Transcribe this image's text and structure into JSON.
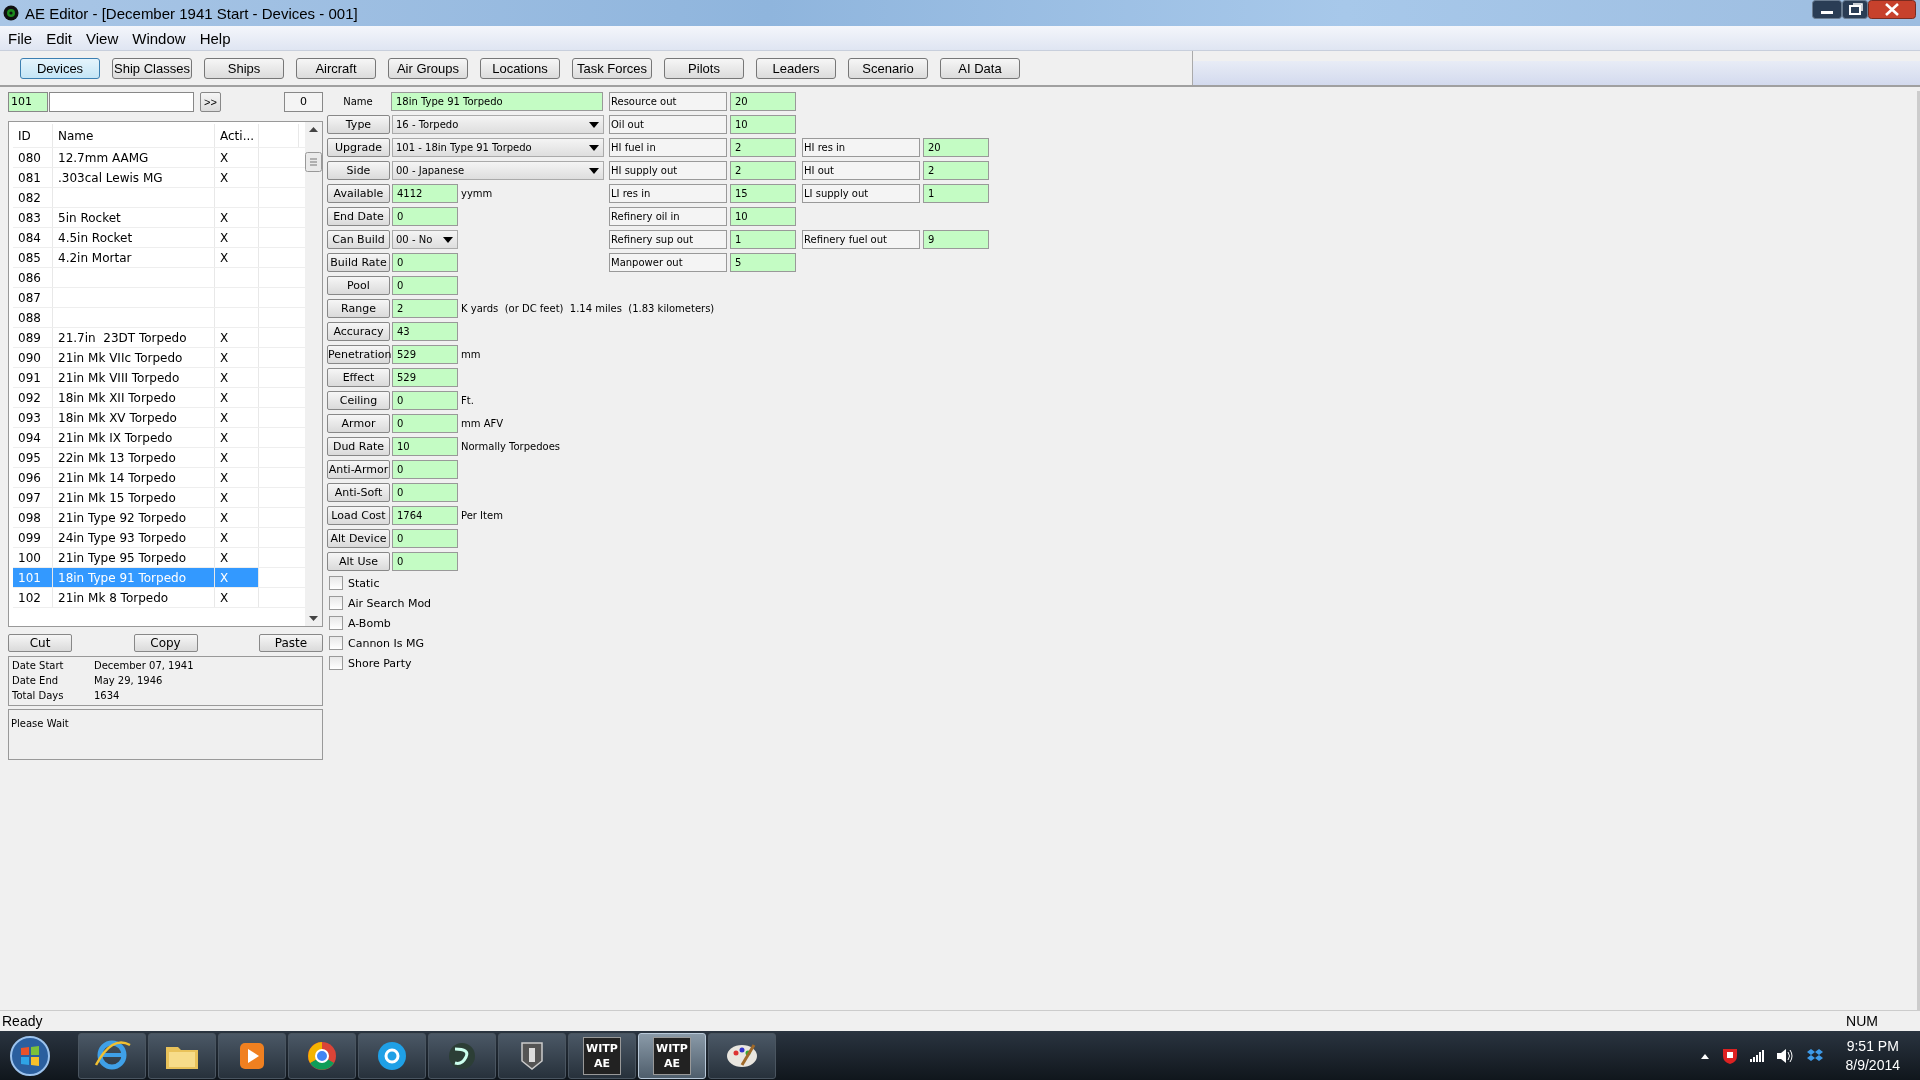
{
  "window": {
    "title": "AE Editor - [December 1941 Start - Devices - 001]"
  },
  "menu": [
    "File",
    "Edit",
    "View",
    "Window",
    "Help"
  ],
  "tabs": [
    {
      "label": "Devices",
      "selected": true
    },
    {
      "label": "Ship Classes",
      "selected": false
    },
    {
      "label": "Ships",
      "selected": false
    },
    {
      "label": "Aircraft",
      "selected": false
    },
    {
      "label": "Air Groups",
      "selected": false
    },
    {
      "label": "Locations",
      "selected": false
    },
    {
      "label": "Task Forces",
      "selected": false
    },
    {
      "label": "Pilots",
      "selected": false
    },
    {
      "label": "Leaders",
      "selected": false
    },
    {
      "label": "Scenario",
      "selected": false
    },
    {
      "label": "AI Data",
      "selected": false
    }
  ],
  "finder": {
    "id_value": "101",
    "go_button": ">>",
    "counter": "0"
  },
  "device_list": {
    "columns": [
      "ID",
      "Name",
      "Acti..."
    ],
    "rows": [
      {
        "id": "080",
        "name": "12.7mm AAMG",
        "active": "X",
        "selected": false
      },
      {
        "id": "081",
        "name": ".303cal Lewis MG",
        "active": "X",
        "selected": false
      },
      {
        "id": "082",
        "selected": false
      },
      {
        "id": "083",
        "name": "5in Rocket",
        "active": "X",
        "selected": false
      },
      {
        "id": "084",
        "name": "4.5in Rocket",
        "active": "X",
        "selected": false
      },
      {
        "id": "085",
        "name": "4.2in Mortar",
        "active": "X",
        "selected": false
      },
      {
        "id": "086",
        "selected": false
      },
      {
        "id": "087",
        "selected": false
      },
      {
        "id": "088",
        "selected": false
      },
      {
        "id": "089",
        "name": "21.7in  23DT Torpedo",
        "active": "X",
        "selected": false
      },
      {
        "id": "090",
        "name": "21in Mk VIIc Torpedo",
        "active": "X",
        "selected": false
      },
      {
        "id": "091",
        "name": "21in Mk VIII Torpedo",
        "active": "X",
        "selected": false
      },
      {
        "id": "092",
        "name": "18in Mk XII Torpedo",
        "active": "X",
        "selected": false
      },
      {
        "id": "093",
        "name": "18in Mk XV Torpedo",
        "active": "X",
        "selected": false
      },
      {
        "id": "094",
        "name": "21in Mk IX Torpedo",
        "active": "X",
        "selected": false
      },
      {
        "id": "095",
        "name": "22in Mk 13 Torpedo",
        "active": "X",
        "selected": false
      },
      {
        "id": "096",
        "name": "21in Mk 14 Torpedo",
        "active": "X",
        "selected": false
      },
      {
        "id": "097",
        "name": "21in Mk 15 Torpedo",
        "active": "X",
        "selected": false
      },
      {
        "id": "098",
        "name": "21in Type 92 Torpedo",
        "active": "X",
        "selected": false
      },
      {
        "id": "099",
        "name": "24in Type 93 Torpedo",
        "active": "X",
        "selected": false
      },
      {
        "id": "100",
        "name": "21in Type 95 Torpedo",
        "active": "X",
        "selected": false
      },
      {
        "id": "101",
        "name": "18in Type 91 Torpedo",
        "active": "X",
        "selected": true
      },
      {
        "id": "102",
        "name": "21in Mk 8 Torpedo",
        "active": "X",
        "selected": false
      }
    ]
  },
  "clipboard_buttons": [
    "Cut",
    "Copy",
    "Paste"
  ],
  "dates": [
    {
      "label": "Date Start",
      "value": "December 07, 1941"
    },
    {
      "label": "Date End",
      "value": "May 29, 1946"
    },
    {
      "label": "Total Days",
      "value": "1634"
    }
  ],
  "log": "Please Wait",
  "form": [
    {
      "kind": "text",
      "label": "Name",
      "value": "18in Type 91 Torpedo"
    },
    {
      "kind": "select",
      "label": "Type",
      "value": "16 - Torpedo"
    },
    {
      "kind": "select",
      "label": "Upgrade",
      "value": "101 - 18in Type 91 Torpedo"
    },
    {
      "kind": "select",
      "label": "Side",
      "value": "00 - Japanese"
    },
    {
      "kind": "input",
      "label": "Available",
      "value": "4112",
      "unit": "yymm"
    },
    {
      "kind": "input",
      "label": "End Date",
      "value": "0"
    },
    {
      "kind": "small_select",
      "label": "Can Build",
      "value": "00 - No"
    },
    {
      "kind": "input",
      "label": "Build Rate",
      "value": "0"
    },
    {
      "kind": "input",
      "label": "Pool",
      "value": "0"
    },
    {
      "kind": "input",
      "label": "Range",
      "value": "2",
      "unit": "K yards  (or DC feet)  1.14 miles  (1.83 kilometers)"
    },
    {
      "kind": "input",
      "label": "Accuracy",
      "value": "43"
    },
    {
      "kind": "input",
      "label": "Penetration",
      "value": "529",
      "unit": "mm"
    },
    {
      "kind": "input",
      "label": "Effect",
      "value": "529"
    },
    {
      "kind": "input",
      "label": "Ceiling",
      "value": "0",
      "unit": "Ft."
    },
    {
      "kind": "input",
      "label": "Armor",
      "value": "0",
      "unit": "mm AFV"
    },
    {
      "kind": "input",
      "label": "Dud Rate",
      "value": "10",
      "unit": "Normally Torpedoes"
    },
    {
      "kind": "input",
      "label": "Anti-Armor",
      "value": "0"
    },
    {
      "kind": "input",
      "label": "Anti-Soft",
      "value": "0"
    },
    {
      "kind": "input",
      "label": "Load Cost",
      "value": "1764",
      "unit": "Per Item"
    },
    {
      "kind": "input",
      "label": "Alt Device",
      "value": "0"
    },
    {
      "kind": "input",
      "label": "Alt Use",
      "value": "0"
    }
  ],
  "flags": [
    {
      "label": "Static",
      "checked": false
    },
    {
      "label": "Air Search Mod",
      "checked": false
    },
    {
      "label": "A-Bomb",
      "checked": false
    },
    {
      "label": "Cannon Is MG",
      "checked": false
    },
    {
      "label": "Shore Party",
      "checked": false
    }
  ],
  "resources": [
    [
      {
        "label": "Resource out",
        "value": "20"
      }
    ],
    [
      {
        "label": "Oil out",
        "value": "10"
      }
    ],
    [
      {
        "label": "HI fuel in",
        "value": "2"
      },
      {
        "label": "HI res in",
        "value": "20"
      }
    ],
    [
      {
        "label": "HI supply out",
        "value": "2"
      },
      {
        "label": "HI out",
        "value": "2"
      }
    ],
    [
      {
        "label": "LI res in",
        "value": "15"
      },
      {
        "label": "LI supply out",
        "value": "1"
      }
    ],
    [
      {
        "label": "Refinery oil in",
        "value": "10"
      }
    ],
    [
      {
        "label": "Refinery sup out",
        "value": "1"
      },
      {
        "label": "Refinery fuel out",
        "value": "9"
      }
    ],
    [
      {
        "label": "Manpower out",
        "value": "5"
      }
    ]
  ],
  "status_bar": {
    "text": "Ready",
    "num": "NUM"
  },
  "taskbar": {
    "apps": [
      {
        "kind": "browser_e",
        "active": false
      },
      {
        "kind": "folder",
        "active": false
      },
      {
        "kind": "media",
        "active": false
      },
      {
        "kind": "ring",
        "active": false
      },
      {
        "kind": "chat",
        "active": false
      },
      {
        "kind": "swirl",
        "active": false
      },
      {
        "kind": "tank",
        "active": false
      },
      {
        "kind": "game",
        "label": "WITP AE",
        "active": false
      },
      {
        "kind": "game",
        "label": "WITP AE",
        "active": true
      },
      {
        "kind": "paint",
        "active": false
      }
    ],
    "time": "9:51 PM",
    "date": "8/9/2014"
  }
}
